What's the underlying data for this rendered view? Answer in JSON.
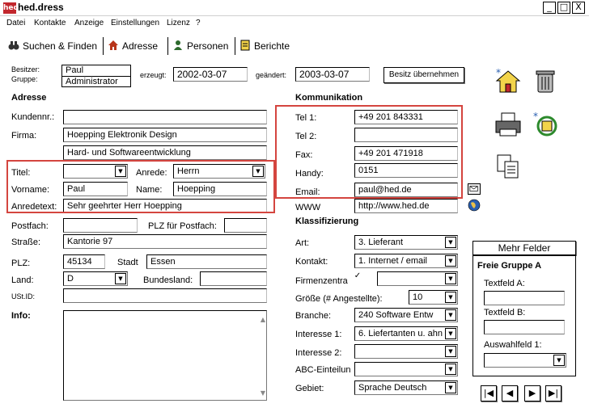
{
  "window": {
    "title": "hed.dress",
    "app_icon_text": "hed",
    "minimize": "_",
    "maximize": "□",
    "close": "X"
  },
  "menu": [
    "Datei",
    "Kontakte",
    "Anzeige",
    "Einstellungen",
    "Lizenz",
    "?"
  ],
  "tabs": [
    "Suchen & Finden",
    "Adresse",
    "Personen",
    "Berichte"
  ],
  "owner": {
    "besitzer_label": "Besitzer:",
    "gruppe_label": "Gruppe:",
    "besitzer": "Paul",
    "gruppe": "Administrator",
    "erzeugt_label": "erzeugt:",
    "erzeugt": "2002-03-07",
    "geaendert_label": "geändert:",
    "geaendert": "2003-03-07",
    "besitz_button": "Besitz übernehmen"
  },
  "adresse": {
    "section_title": "Adresse",
    "kundennr_label": "Kundennr.:",
    "kundennr": "",
    "firma_label": "Firma:",
    "firma1": "Hoepping Elektronik Design",
    "firma2": "Hard- und Softwareentwicklung",
    "titel_label": "Titel:",
    "titel": "",
    "anrede_label": "Anrede:",
    "anrede": "Herrn",
    "vorname_label": "Vorname:",
    "vorname": "Paul",
    "name_label": "Name:",
    "name": "Hoepping",
    "anredetext_label": "Anredetext:",
    "anredetext": "Sehr geehrter Herr Hoepping",
    "postfach_label": "Postfach:",
    "postfach": "",
    "plz_postfach_label": "PLZ für Postfach:",
    "plz_postfach": "",
    "strasse_label": "Straße:",
    "strasse": "Kantorie 97",
    "plz_label": "PLZ:",
    "plz": "45134",
    "stadt_label": "Stadt",
    "stadt": "Essen",
    "land_label": "Land:",
    "land": "D",
    "bundesland_label": "Bundesland:",
    "bundesland": "",
    "ustid_label": "USt.ID:",
    "ustid": "",
    "info_label": "Info:"
  },
  "kommunikation": {
    "section_title": "Kommunikation",
    "tel1_label": "Tel 1:",
    "tel1": "+49 201 843331",
    "tel2_label": "Tel 2:",
    "tel2": "",
    "fax_label": "Fax:",
    "fax": "+49 201 471918",
    "handy_label": "Handy:",
    "handy": "0151",
    "email_label": "Email:",
    "email": "paul@hed.de",
    "www_label": "WWW",
    "www": "http://www.hed.de"
  },
  "klassifizierung": {
    "section_title": "Klassifizierung",
    "art_label": "Art:",
    "art": "3. Lieferant",
    "kontakt_label": "Kontakt:",
    "kontakt": "1. Internet / email",
    "firmenzentrale_label": "Firmenzentra",
    "firmenzentrale_check": "✓",
    "groesse_label": "Größe (# Angestellte):",
    "groesse": "10",
    "branche_label": "Branche:",
    "branche": "240 Software Entw",
    "interesse1_label": "Interesse 1:",
    "interesse1": "6. Liefertanten u. ahn",
    "interesse2_label": "Interesse 2:",
    "interesse2": "",
    "abc_label": "ABC-Einteilun",
    "abc": "",
    "gebiet_label": "Gebiet:",
    "gebiet": "Sprache Deutsch"
  },
  "mehr_felder": {
    "button": "Mehr Felder",
    "group_title": "Freie Gruppe A",
    "textfeld_a_label": "Textfeld A:",
    "textfeld_a": "",
    "textfeld_b_label": "Textfeld B:",
    "textfeld_b": "",
    "auswahlfeld_label": "Auswahlfeld 1:",
    "auswahlfeld": ""
  },
  "nav": {
    "first": "|◀",
    "prev": "◀",
    "next": "▶",
    "last": "▶|"
  },
  "icons": [
    "new-house-icon",
    "trash-icon",
    "print-icon",
    "refresh-icon",
    "copy-icon",
    "email-small-icon",
    "globe-icon"
  ],
  "colors": {
    "highlight_red": "#d4453f",
    "app_icon_red": "#c2272d"
  }
}
